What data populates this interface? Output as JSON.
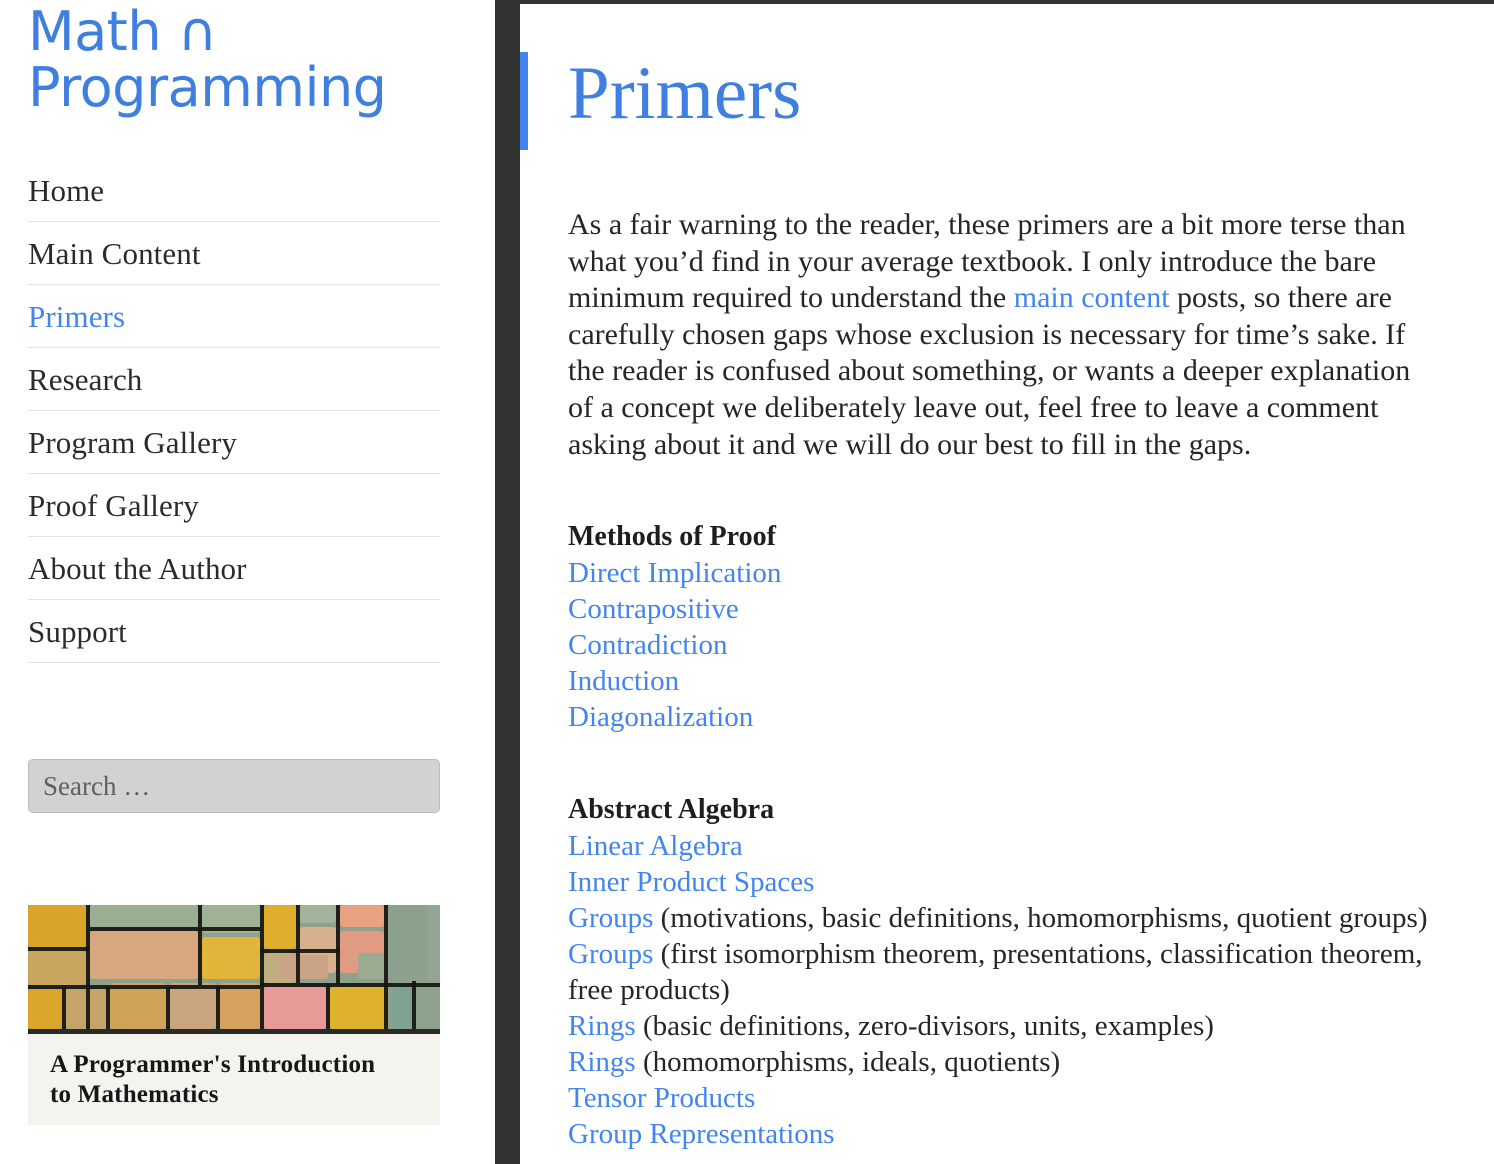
{
  "sidebar": {
    "site_title_line1": "Math ∩",
    "site_title_line2": "Programming",
    "nav": [
      {
        "label": "Home",
        "active": false
      },
      {
        "label": "Main Content",
        "active": false
      },
      {
        "label": "Primers",
        "active": true
      },
      {
        "label": "Research",
        "active": false
      },
      {
        "label": "Program Gallery",
        "active": false
      },
      {
        "label": "Proof Gallery",
        "active": false
      },
      {
        "label": "About the Author",
        "active": false
      },
      {
        "label": "Support",
        "active": false
      }
    ],
    "search": {
      "placeholder": "Search …",
      "value": ""
    },
    "book": {
      "title_line1": "A Programmer's Introduction",
      "title_line2": "to Mathematics"
    }
  },
  "main": {
    "title": "Primers",
    "intro_part1": "As a fair warning to the reader, these primers are a bit more terse than what you’d find in your average textbook. I only introduce the bare minimum required to understand the ",
    "intro_link": "main content",
    "intro_part2": " posts, so there are carefully chosen gaps whose exclusion is necessary for time’s sake. If the reader is confused about something, or wants a deeper explanation of a concept we deliberately leave out, feel free to leave a comment asking about it and we will do our best to fill in the gaps.",
    "sections": [
      {
        "heading": "Methods of Proof",
        "entries": [
          {
            "link": "Direct Implication",
            "note": ""
          },
          {
            "link": "Contrapositive",
            "note": ""
          },
          {
            "link": "Contradiction",
            "note": ""
          },
          {
            "link": "Induction",
            "note": ""
          },
          {
            "link": "Diagonalization",
            "note": ""
          }
        ]
      },
      {
        "heading": "Abstract Algebra",
        "entries": [
          {
            "link": "Linear Algebra",
            "note": ""
          },
          {
            "link": "Inner Product Spaces",
            "note": ""
          },
          {
            "link": "Groups",
            "note": " (motivations, basic definitions, homomorphisms, quotient groups)"
          },
          {
            "link": "Groups",
            "note": " (first isomorphism theorem, presentations, classification theorem, free products)"
          },
          {
            "link": "Rings",
            "note": " (basic definitions, zero-divisors, units, examples)"
          },
          {
            "link": "Rings",
            "note": " (homomorphisms, ideals, quotients)"
          },
          {
            "link": "Tensor Products",
            "note": ""
          },
          {
            "link": "Group Representations",
            "note": ""
          }
        ]
      }
    ]
  },
  "colors": {
    "accent_blue": "#4285ee",
    "title_blue": "#3f7fe0",
    "dark_chrome": "#333333",
    "text": "#25252a",
    "divider": "#e2e2e2",
    "search_bg": "#d2d2d2"
  }
}
